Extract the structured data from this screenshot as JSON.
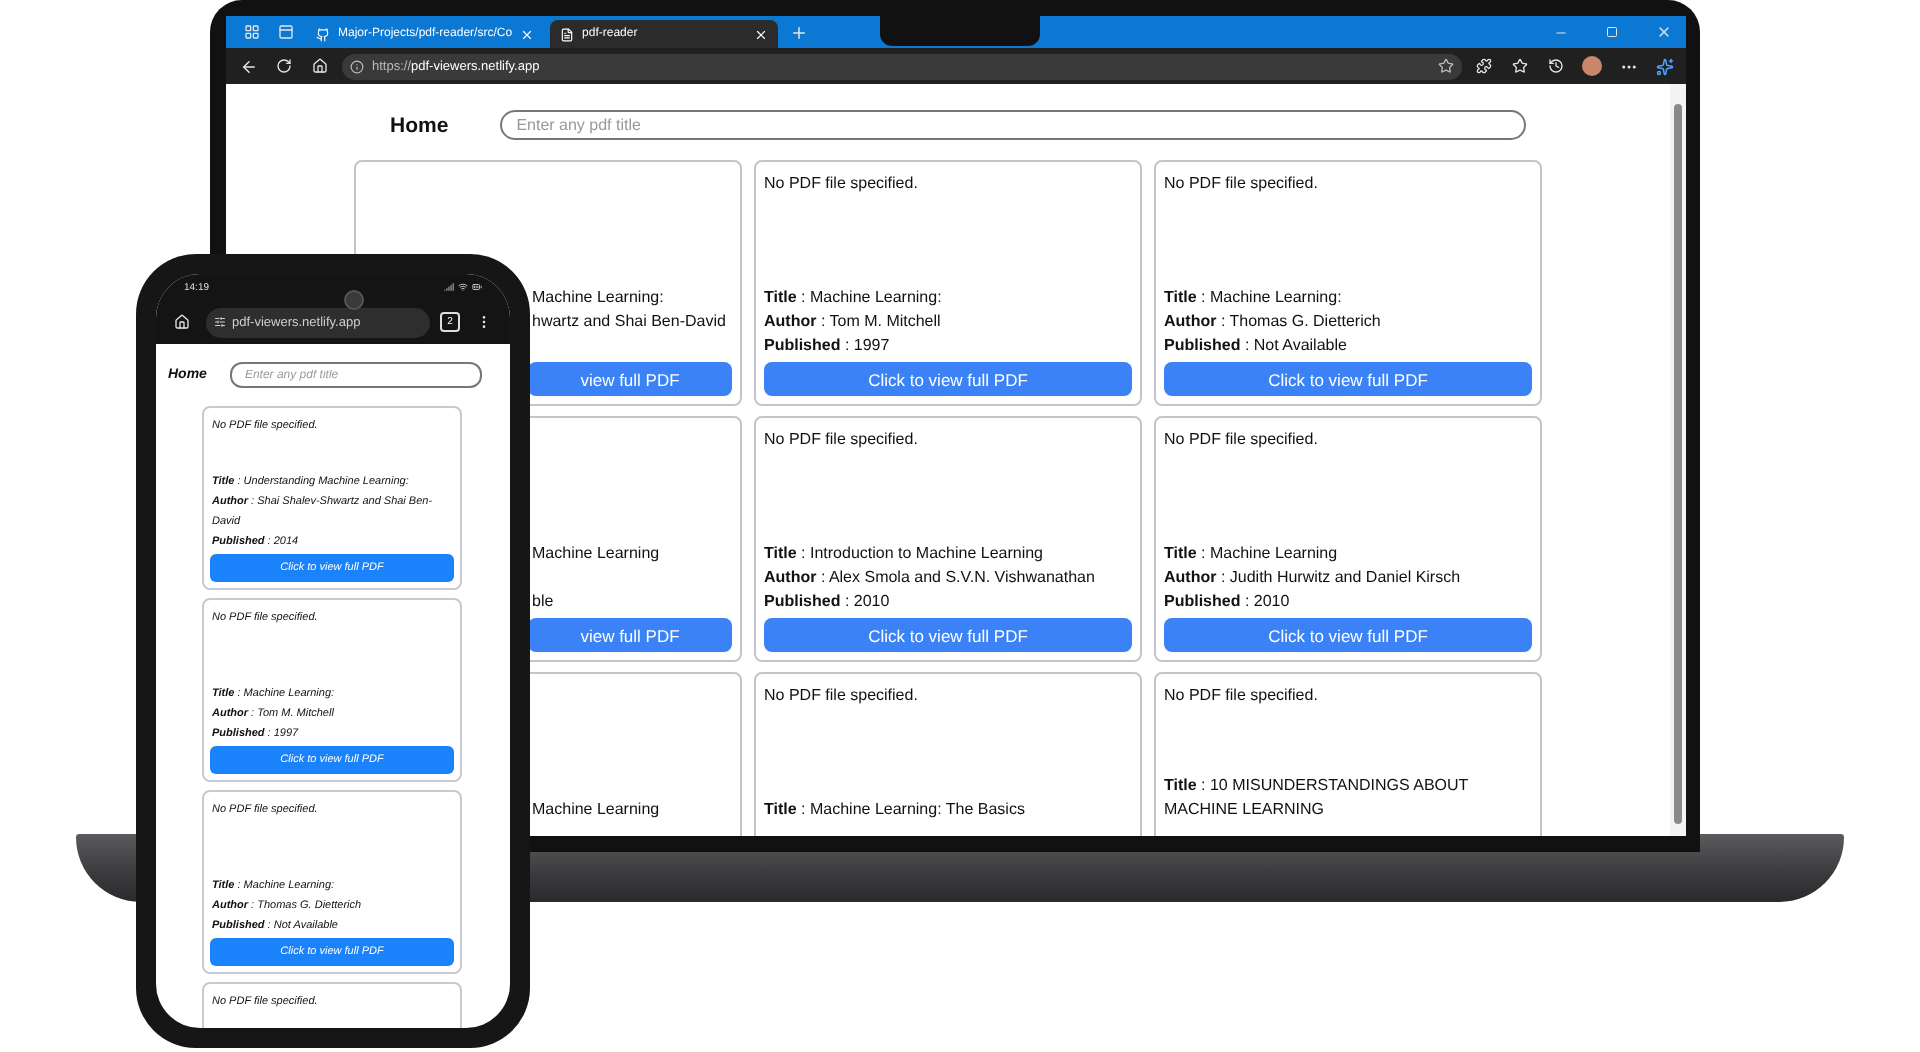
{
  "laptop": {
    "browser": {
      "tabs": [
        {
          "title": "Major-Projects/pdf-reader/src/Co",
          "selected": false
        },
        {
          "title": "pdf-reader",
          "selected": true
        }
      ],
      "url": "https://**pdf-viewers.netlify.app**"
    },
    "page": {
      "home": "Home",
      "search": {
        "placeholder": "Enter any pdf title"
      },
      "cards": [
        {
          "kind": "covered",
          "title": "Machine Learning:",
          "author": "hwartz and Shai Ben-David",
          "button": "view full PDF"
        },
        {
          "kind": "full",
          "message": "No PDF file specified.",
          "fields": [
            "**Title** : Machine Learning:",
            "**Author** : Tom M. Mitchell",
            "**Published** : 1997"
          ],
          "button": "Click to view full PDF"
        },
        {
          "kind": "full",
          "message": "No PDF file specified.",
          "fields": [
            "**Title** : Machine Learning:",
            "**Author** : Thomas G. Dietterich",
            "**Published** : Not Available"
          ],
          "button": "Click to view full PDF"
        },
        {
          "kind": "covered",
          "title": "Machine Learning",
          "published": "ble",
          "button": "view full PDF"
        },
        {
          "kind": "full",
          "message": "No PDF file specified.",
          "fields": [
            "**Title** : Introduction to Machine Learning",
            "**Author** : Alex Smola and S.V.N. Vishwanathan",
            "**Published** : 2010"
          ],
          "button": "Click to view full PDF"
        },
        {
          "kind": "full",
          "message": "No PDF file specified.",
          "fields": [
            "**Title** : Machine Learning",
            "**Author** : Judith Hurwitz and Daniel Kirsch",
            "**Published** : 2010"
          ],
          "button": "Click to view full PDF"
        },
        {
          "kind": "covered",
          "title": "Machine Learning"
        },
        {
          "kind": "full",
          "message": "No PDF file specified.",
          "fields": [
            "**Title** : Machine Learning: The Basics"
          ]
        },
        {
          "kind": "full",
          "message": "No PDF file specified.",
          "fields": [
            "**Title** : 10 MISUNDERSTANDINGS ABOUT MACHINE LEARNING"
          ]
        }
      ]
    }
  },
  "phone": {
    "status": {
      "time": "14:19"
    },
    "browser": {
      "url": "pdf-viewers.netlify.app",
      "tab_count": "2"
    },
    "page": {
      "home": "Home",
      "search": {
        "placeholder": "Enter any pdf title"
      },
      "cards": [
        {
          "message": "No PDF file specified.",
          "fields": [
            "**Title** : Understanding Machine Learning:",
            "**Author** : Shai Shalev-Shwartz and Shai Ben-David",
            "**Published** : 2014"
          ],
          "button": "Click to view full PDF"
        },
        {
          "message": "No PDF file specified.",
          "fields": [
            "**Title** : Machine Learning:",
            "**Author** : Tom M. Mitchell",
            "**Published** : 1997"
          ],
          "button": "Click to view full PDF"
        },
        {
          "message": "No PDF file specified.",
          "fields": [
            "**Title** : Machine Learning:",
            "**Author** : Thomas G. Dietterich",
            "**Published** : Not Available"
          ],
          "button": "Click to view full PDF"
        },
        {
          "message": "No PDF file specified."
        }
      ]
    }
  }
}
